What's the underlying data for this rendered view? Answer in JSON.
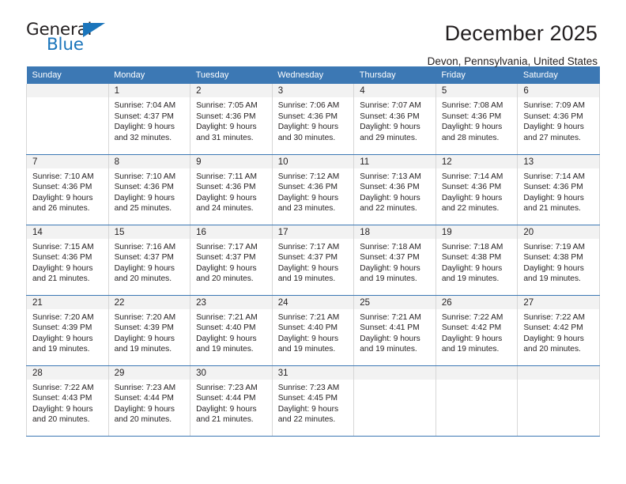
{
  "brand": {
    "name_part1": "General",
    "name_part2": "Blue",
    "accent_color": "#1b75bb"
  },
  "header": {
    "title": "December 2025",
    "subtitle": "Devon, Pennsylvania, United States"
  },
  "calendar": {
    "header_bg": "#3c78b4",
    "weekdays": [
      "Sunday",
      "Monday",
      "Tuesday",
      "Wednesday",
      "Thursday",
      "Friday",
      "Saturday"
    ],
    "labels": {
      "sunrise": "Sunrise:",
      "sunset": "Sunset:",
      "daylight": "Daylight:"
    },
    "weeks": [
      [
        {
          "day": "",
          "sunrise": "",
          "sunset": "",
          "daylight": ""
        },
        {
          "day": "1",
          "sunrise": "Sunrise: 7:04 AM",
          "sunset": "Sunset: 4:37 PM",
          "daylight": "Daylight: 9 hours and 32 minutes."
        },
        {
          "day": "2",
          "sunrise": "Sunrise: 7:05 AM",
          "sunset": "Sunset: 4:36 PM",
          "daylight": "Daylight: 9 hours and 31 minutes."
        },
        {
          "day": "3",
          "sunrise": "Sunrise: 7:06 AM",
          "sunset": "Sunset: 4:36 PM",
          "daylight": "Daylight: 9 hours and 30 minutes."
        },
        {
          "day": "4",
          "sunrise": "Sunrise: 7:07 AM",
          "sunset": "Sunset: 4:36 PM",
          "daylight": "Daylight: 9 hours and 29 minutes."
        },
        {
          "day": "5",
          "sunrise": "Sunrise: 7:08 AM",
          "sunset": "Sunset: 4:36 PM",
          "daylight": "Daylight: 9 hours and 28 minutes."
        },
        {
          "day": "6",
          "sunrise": "Sunrise: 7:09 AM",
          "sunset": "Sunset: 4:36 PM",
          "daylight": "Daylight: 9 hours and 27 minutes."
        }
      ],
      [
        {
          "day": "7",
          "sunrise": "Sunrise: 7:10 AM",
          "sunset": "Sunset: 4:36 PM",
          "daylight": "Daylight: 9 hours and 26 minutes."
        },
        {
          "day": "8",
          "sunrise": "Sunrise: 7:10 AM",
          "sunset": "Sunset: 4:36 PM",
          "daylight": "Daylight: 9 hours and 25 minutes."
        },
        {
          "day": "9",
          "sunrise": "Sunrise: 7:11 AM",
          "sunset": "Sunset: 4:36 PM",
          "daylight": "Daylight: 9 hours and 24 minutes."
        },
        {
          "day": "10",
          "sunrise": "Sunrise: 7:12 AM",
          "sunset": "Sunset: 4:36 PM",
          "daylight": "Daylight: 9 hours and 23 minutes."
        },
        {
          "day": "11",
          "sunrise": "Sunrise: 7:13 AM",
          "sunset": "Sunset: 4:36 PM",
          "daylight": "Daylight: 9 hours and 22 minutes."
        },
        {
          "day": "12",
          "sunrise": "Sunrise: 7:14 AM",
          "sunset": "Sunset: 4:36 PM",
          "daylight": "Daylight: 9 hours and 22 minutes."
        },
        {
          "day": "13",
          "sunrise": "Sunrise: 7:14 AM",
          "sunset": "Sunset: 4:36 PM",
          "daylight": "Daylight: 9 hours and 21 minutes."
        }
      ],
      [
        {
          "day": "14",
          "sunrise": "Sunrise: 7:15 AM",
          "sunset": "Sunset: 4:36 PM",
          "daylight": "Daylight: 9 hours and 21 minutes."
        },
        {
          "day": "15",
          "sunrise": "Sunrise: 7:16 AM",
          "sunset": "Sunset: 4:37 PM",
          "daylight": "Daylight: 9 hours and 20 minutes."
        },
        {
          "day": "16",
          "sunrise": "Sunrise: 7:17 AM",
          "sunset": "Sunset: 4:37 PM",
          "daylight": "Daylight: 9 hours and 20 minutes."
        },
        {
          "day": "17",
          "sunrise": "Sunrise: 7:17 AM",
          "sunset": "Sunset: 4:37 PM",
          "daylight": "Daylight: 9 hours and 19 minutes."
        },
        {
          "day": "18",
          "sunrise": "Sunrise: 7:18 AM",
          "sunset": "Sunset: 4:37 PM",
          "daylight": "Daylight: 9 hours and 19 minutes."
        },
        {
          "day": "19",
          "sunrise": "Sunrise: 7:18 AM",
          "sunset": "Sunset: 4:38 PM",
          "daylight": "Daylight: 9 hours and 19 minutes."
        },
        {
          "day": "20",
          "sunrise": "Sunrise: 7:19 AM",
          "sunset": "Sunset: 4:38 PM",
          "daylight": "Daylight: 9 hours and 19 minutes."
        }
      ],
      [
        {
          "day": "21",
          "sunrise": "Sunrise: 7:20 AM",
          "sunset": "Sunset: 4:39 PM",
          "daylight": "Daylight: 9 hours and 19 minutes."
        },
        {
          "day": "22",
          "sunrise": "Sunrise: 7:20 AM",
          "sunset": "Sunset: 4:39 PM",
          "daylight": "Daylight: 9 hours and 19 minutes."
        },
        {
          "day": "23",
          "sunrise": "Sunrise: 7:21 AM",
          "sunset": "Sunset: 4:40 PM",
          "daylight": "Daylight: 9 hours and 19 minutes."
        },
        {
          "day": "24",
          "sunrise": "Sunrise: 7:21 AM",
          "sunset": "Sunset: 4:40 PM",
          "daylight": "Daylight: 9 hours and 19 minutes."
        },
        {
          "day": "25",
          "sunrise": "Sunrise: 7:21 AM",
          "sunset": "Sunset: 4:41 PM",
          "daylight": "Daylight: 9 hours and 19 minutes."
        },
        {
          "day": "26",
          "sunrise": "Sunrise: 7:22 AM",
          "sunset": "Sunset: 4:42 PM",
          "daylight": "Daylight: 9 hours and 19 minutes."
        },
        {
          "day": "27",
          "sunrise": "Sunrise: 7:22 AM",
          "sunset": "Sunset: 4:42 PM",
          "daylight": "Daylight: 9 hours and 20 minutes."
        }
      ],
      [
        {
          "day": "28",
          "sunrise": "Sunrise: 7:22 AM",
          "sunset": "Sunset: 4:43 PM",
          "daylight": "Daylight: 9 hours and 20 minutes."
        },
        {
          "day": "29",
          "sunrise": "Sunrise: 7:23 AM",
          "sunset": "Sunset: 4:44 PM",
          "daylight": "Daylight: 9 hours and 20 minutes."
        },
        {
          "day": "30",
          "sunrise": "Sunrise: 7:23 AM",
          "sunset": "Sunset: 4:44 PM",
          "daylight": "Daylight: 9 hours and 21 minutes."
        },
        {
          "day": "31",
          "sunrise": "Sunrise: 7:23 AM",
          "sunset": "Sunset: 4:45 PM",
          "daylight": "Daylight: 9 hours and 22 minutes."
        },
        {
          "day": "",
          "sunrise": "",
          "sunset": "",
          "daylight": ""
        },
        {
          "day": "",
          "sunrise": "",
          "sunset": "",
          "daylight": ""
        },
        {
          "day": "",
          "sunrise": "",
          "sunset": "",
          "daylight": ""
        }
      ]
    ]
  }
}
